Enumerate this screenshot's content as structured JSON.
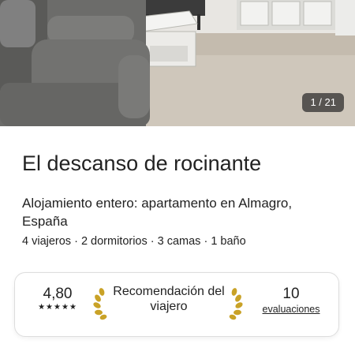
{
  "gallery": {
    "counter": "1 / 21"
  },
  "listing": {
    "title": "El descanso de rocinante",
    "subtitle": "Alojamiento entero: apartamento en Almagro, España",
    "details": "4 viajeros · 2 dormitorios · 3 camas · 1 baño"
  },
  "highlights": {
    "rating": "4,80",
    "stars": "★★★★★",
    "star_count": 5,
    "badge": "Recomendación del viajero",
    "reviews_count": "10",
    "reviews_label": "evaluaciones"
  },
  "colors": {
    "text": "#222222",
    "laurel": "#c9a227",
    "counter_bg": "#3a3a3a"
  },
  "icons": {
    "laurels": "laurel-icon"
  }
}
